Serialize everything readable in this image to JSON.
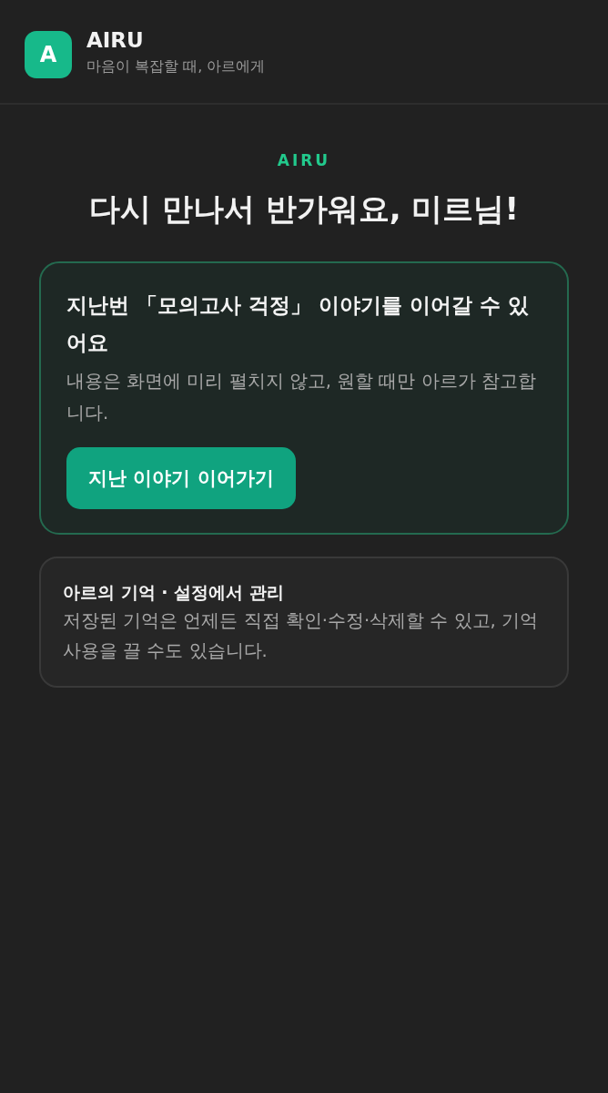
{
  "header": {
    "logo": "A",
    "title": "AIRU",
    "subtitle": "마음이 복잡할 때, 아르에게"
  },
  "hero": {
    "eyebrow": "AIRU",
    "headline": "다시 만나서 반가워요, 미르님!"
  },
  "resume_card": {
    "title": "지난번 「모의고사 걱정」 이야기를 이어갈 수 있어요",
    "description": "내용은 화면에 미리 펼치지 않고, 원할 때만 아르가 참고합니다.",
    "button": "지난 이야기 이어가기"
  },
  "memory_card": {
    "title": "아르의 기억 · 설정에서 관리",
    "description": "저장된 기억은 언제든 직접 확인·수정·삭제할 수 있고, 기억 사용을 끌 수도 있습니다."
  }
}
